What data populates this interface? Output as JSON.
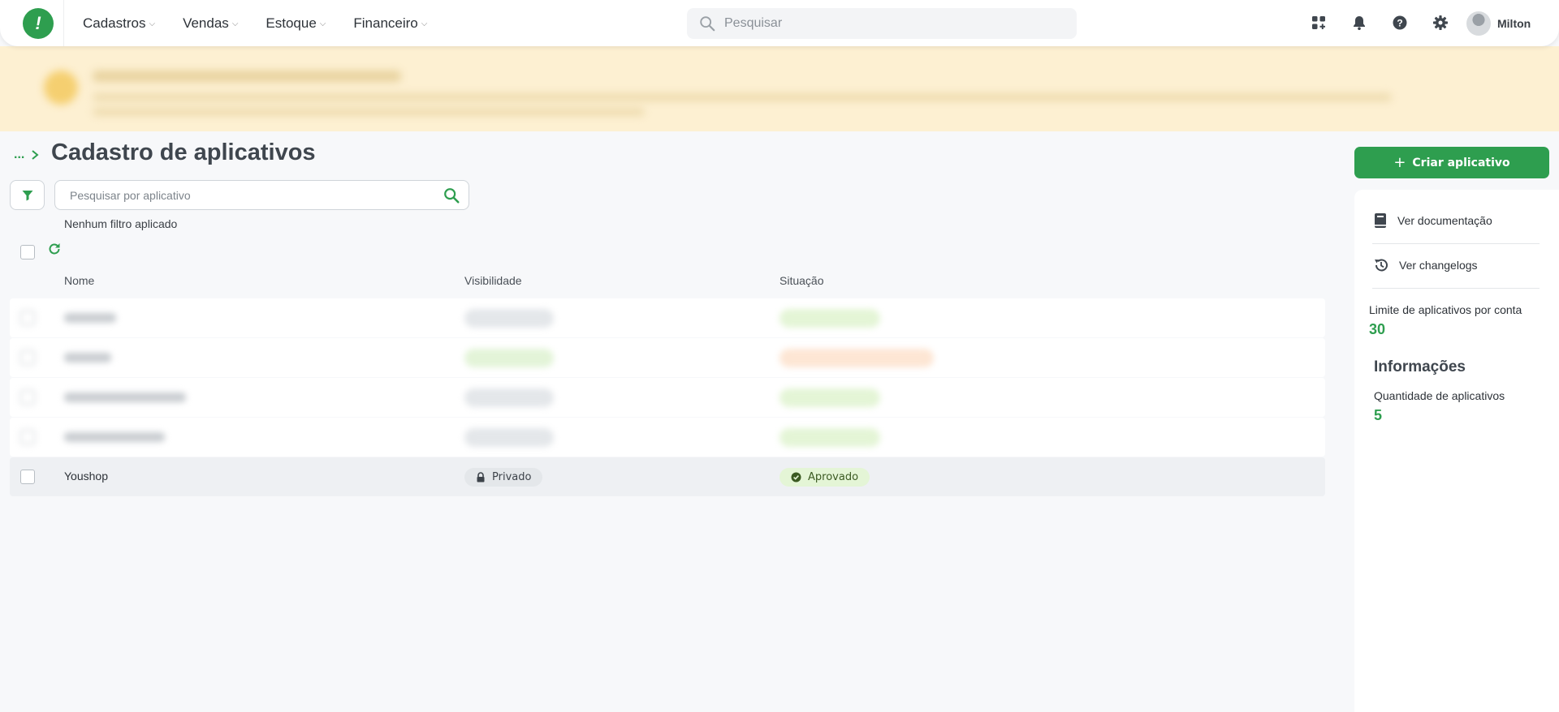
{
  "nav": {
    "items": [
      {
        "label": "Cadastros"
      },
      {
        "label": "Vendas"
      },
      {
        "label": "Estoque"
      },
      {
        "label": "Financeiro"
      }
    ],
    "search_placeholder": "Pesquisar",
    "user_name": "Milton",
    "icons": [
      "apps-icon",
      "bell-icon",
      "help-icon",
      "gear-icon"
    ]
  },
  "breadcrumb": {
    "ellipsis": "..."
  },
  "page": {
    "title": "Cadastro de aplicativos"
  },
  "filters": {
    "search_placeholder": "Pesquisar por aplicativo",
    "status_text": "Nenhum filtro aplicado"
  },
  "table": {
    "columns": [
      "Nome",
      "Visibilidade",
      "Situação"
    ],
    "rows": [
      {
        "name": "",
        "visibility": "",
        "status": ""
      },
      {
        "name": "",
        "visibility": "",
        "status": ""
      },
      {
        "name": "",
        "visibility": "",
        "status": ""
      },
      {
        "name": "",
        "visibility": "",
        "status": ""
      },
      {
        "name": "Youshop",
        "visibility": "Privado",
        "status": "Aprovado"
      }
    ]
  },
  "sidebar": {
    "create_label": "Criar aplicativo",
    "links": [
      {
        "label": "Ver documentação",
        "icon": "book-icon"
      },
      {
        "label": "Ver changelogs",
        "icon": "history-icon"
      }
    ],
    "limit_label": "Limite de aplicativos por conta",
    "limit_value": "30",
    "info_title": "Informações",
    "qty_label": "Quantidade de aplicativos",
    "qty_value": "5"
  },
  "colors": {
    "brand": "#2e9e4f",
    "banner": "#fdf0d2",
    "warning": "#d9783a"
  }
}
